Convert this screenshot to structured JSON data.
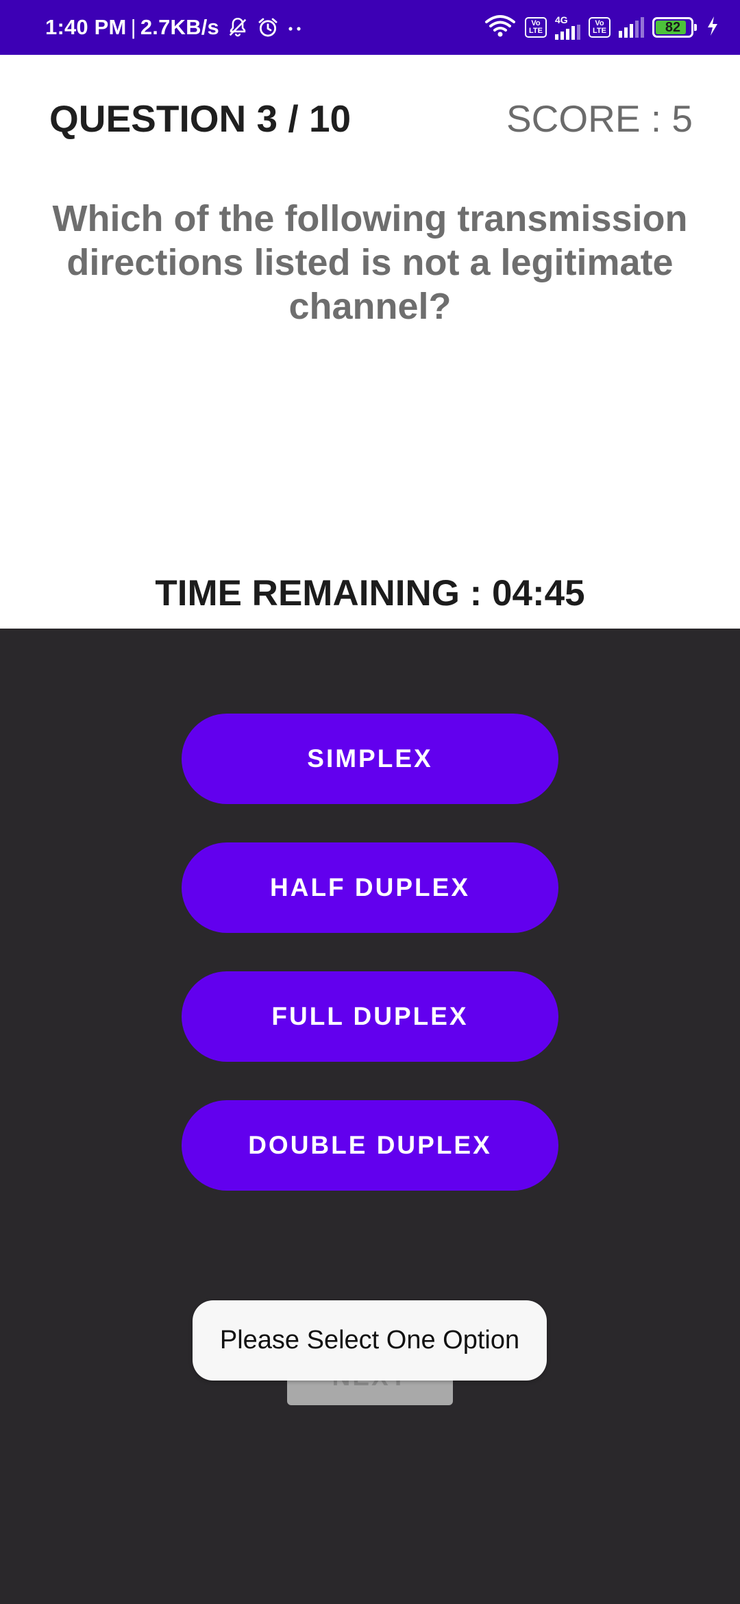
{
  "status_bar": {
    "time": "1:40 PM",
    "separator": "|",
    "net_speed": "2.7KB/s",
    "icons": [
      "mute-notification-icon",
      "alarm-icon",
      "more-dots-icon",
      "wifi-icon",
      "volte-icon",
      "signal-4g-icon",
      "volte-icon",
      "signal-icon",
      "battery-icon",
      "charging-icon"
    ],
    "volte_label_top": "Vo",
    "volte_label_bottom": "LTE",
    "network_type": "4G",
    "battery_level": "82",
    "battery_fill_color": "#4cc23a",
    "background_color": "#3d00b5"
  },
  "header": {
    "question_counter": "QUESTION 3 / 10",
    "score": "SCORE : 5"
  },
  "question": {
    "text": "Which of the following transmission directions listed is not a legitimate channel?"
  },
  "timer": {
    "text": "TIME REMAINING : 04:45"
  },
  "options": [
    {
      "label": "SIMPLEX"
    },
    {
      "label": "HALF DUPLEX"
    },
    {
      "label": "FULL DUPLEX"
    },
    {
      "label": "DOUBLE DUPLEX"
    }
  ],
  "colors": {
    "option_button": "#6200ee",
    "dark_panel": "#2a282b"
  },
  "next_button": {
    "label": "NEXT"
  },
  "toast": {
    "message": "Please Select One Option"
  }
}
